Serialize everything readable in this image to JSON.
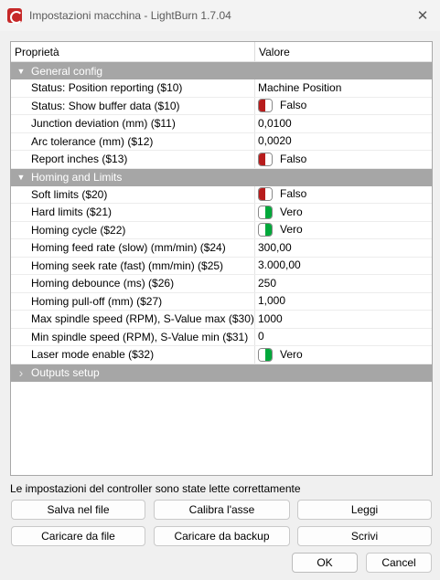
{
  "window": {
    "title": "Impostazioni macchina - LightBurn 1.7.04"
  },
  "grid": {
    "headers": {
      "property": "Proprietà",
      "value": "Valore"
    },
    "categories": [
      {
        "label": "General config",
        "expanded": true,
        "rows": [
          {
            "name": "Status: Position reporting ($10)",
            "value": "Machine Position",
            "toggle": null
          },
          {
            "name": "Status: Show buffer data ($10)",
            "value": "Falso",
            "toggle": "off"
          },
          {
            "name": "Junction deviation (mm) ($11)",
            "value": "0,0100",
            "toggle": null
          },
          {
            "name": "Arc tolerance (mm) ($12)",
            "value": "0,0020",
            "toggle": null
          },
          {
            "name": "Report inches ($13)",
            "value": "Falso",
            "toggle": "off"
          }
        ]
      },
      {
        "label": "Homing and Limits",
        "expanded": true,
        "rows": [
          {
            "name": "Soft limits ($20)",
            "value": "Falso",
            "toggle": "off"
          },
          {
            "name": "Hard limits ($21)",
            "value": "Vero",
            "toggle": "on"
          },
          {
            "name": "Homing cycle ($22)",
            "value": "Vero",
            "toggle": "on"
          },
          {
            "name": "Homing feed rate (slow) (mm/min) ($24)",
            "value": "300,00",
            "toggle": null
          },
          {
            "name": "Homing seek rate (fast) (mm/min) ($25)",
            "value": "3.000,00",
            "toggle": null
          },
          {
            "name": "Homing debounce (ms) ($26)",
            "value": "250",
            "toggle": null
          },
          {
            "name": "Homing pull-off (mm) ($27)",
            "value": "1,000",
            "toggle": null
          },
          {
            "name": "Max spindle speed (RPM), S-Value max ($30)",
            "value": "1000",
            "toggle": null
          },
          {
            "name": "Min spindle speed (RPM), S-Value min ($31)",
            "value": "0",
            "toggle": null
          },
          {
            "name": "Laser mode enable ($32)",
            "value": "Vero",
            "toggle": "on"
          }
        ]
      },
      {
        "label": "Outputs setup",
        "expanded": false,
        "rows": []
      }
    ]
  },
  "status_message": "Le impostazioni del controller sono state lette correttamente",
  "buttons": {
    "save_to_file": "Salva nel file",
    "calibrate_axis": "Calibra l'asse",
    "read": "Leggi",
    "load_from_file": "Caricare da file",
    "load_from_backup": "Caricare da backup",
    "write": "Scrivi",
    "ok": "OK",
    "cancel": "Cancel"
  },
  "colors": {
    "category_bg": "#a6a6a6",
    "toggle_off": "#b71c1c",
    "toggle_on": "#00a83a"
  }
}
